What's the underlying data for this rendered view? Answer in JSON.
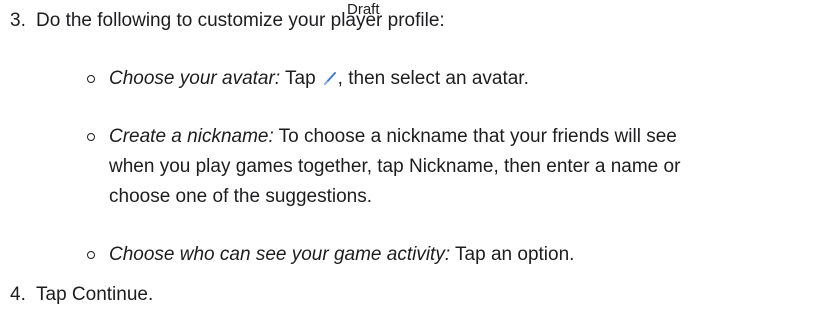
{
  "watermark": "Draft",
  "steps": [
    {
      "number": "3.",
      "text": "Do the following to customize your player profile:",
      "substeps": [
        {
          "label": "Choose your avatar:",
          "text_before_icon": " Tap",
          "icon": "pencil-icon",
          "text_after_icon": ", then select an avatar."
        },
        {
          "label": "Create a nickname:",
          "line1_text": " To choose a nickname that your friends will see",
          "line2": "when you play games together, tap Nickname, then enter a name or",
          "line3": "choose one of the suggestions."
        },
        {
          "label": "Choose who can see your game activity:",
          "text": " Tap an option."
        }
      ]
    },
    {
      "number": "4.",
      "text": "Tap Continue."
    }
  ],
  "colors": {
    "text": "#1d1d1f",
    "icon": "#3a7bd5"
  }
}
